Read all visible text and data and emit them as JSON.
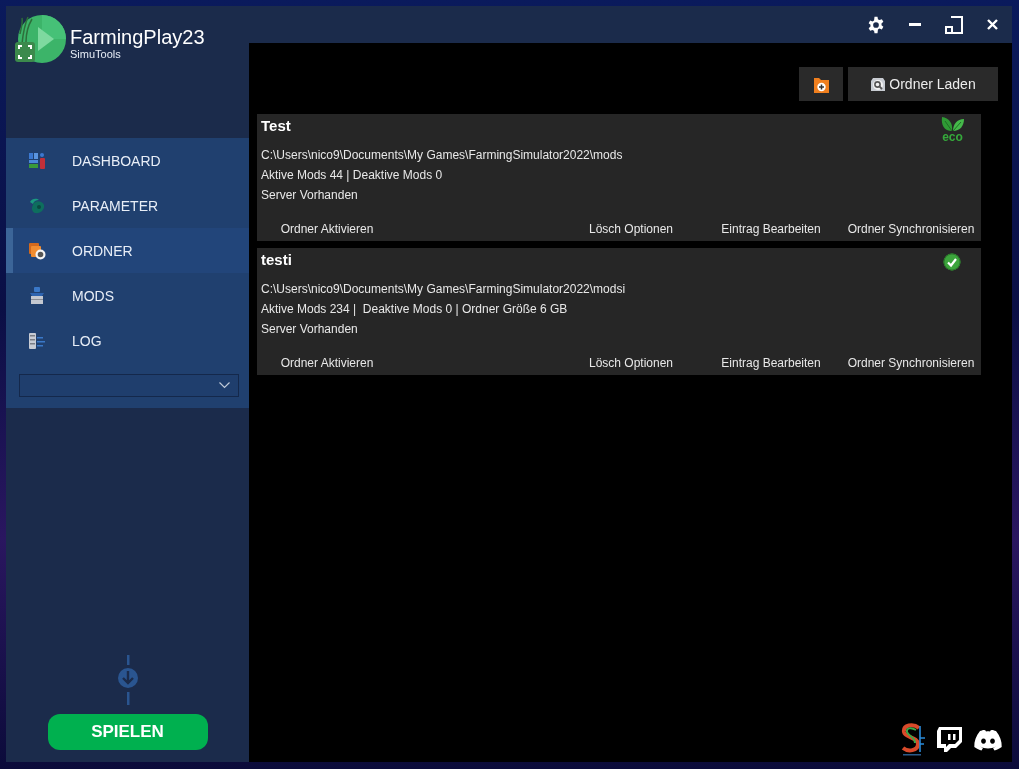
{
  "window": {
    "title": "FarmingPlay23",
    "subtitle": "SimuTools"
  },
  "sidebar": {
    "items": [
      {
        "label": "DASHBOARD",
        "selected": false
      },
      {
        "label": "PARAMETER",
        "selected": false
      },
      {
        "label": "ORDNER",
        "selected": true
      },
      {
        "label": "MODS",
        "selected": false
      },
      {
        "label": "LOG",
        "selected": false
      }
    ],
    "play_button": "SPIELEN"
  },
  "toolbar": {
    "load_button": "Ordner Laden"
  },
  "folders": [
    {
      "name": "Test",
      "path": "C:\\Users\\nico9\\Documents\\My Games\\FarmingSimulator2022\\mods",
      "stats": "Aktive Mods 44 | Deaktive Mods 0",
      "server": "Server Vorhanden",
      "status": {
        "kind": "eco",
        "label": "eco"
      },
      "actions": [
        "Ordner Aktivieren",
        "Lösch Optionen",
        "Eintrag Bearbeiten",
        "Ordner Synchronisieren"
      ]
    },
    {
      "name": "testi",
      "path": "C:\\Users\\nico9\\Documents\\My Games\\FarmingSimulator2022\\modsi",
      "stats": "Aktive Mods 234 |  Deaktive Mods 0 | Ordner Größe 6 GB",
      "server": "Server Vorhanden",
      "status": {
        "kind": "check"
      },
      "actions": [
        "Ordner Aktivieren",
        "Lösch Optionen",
        "Eintrag Bearbeiten",
        "Ordner Synchronisieren"
      ]
    }
  ]
}
